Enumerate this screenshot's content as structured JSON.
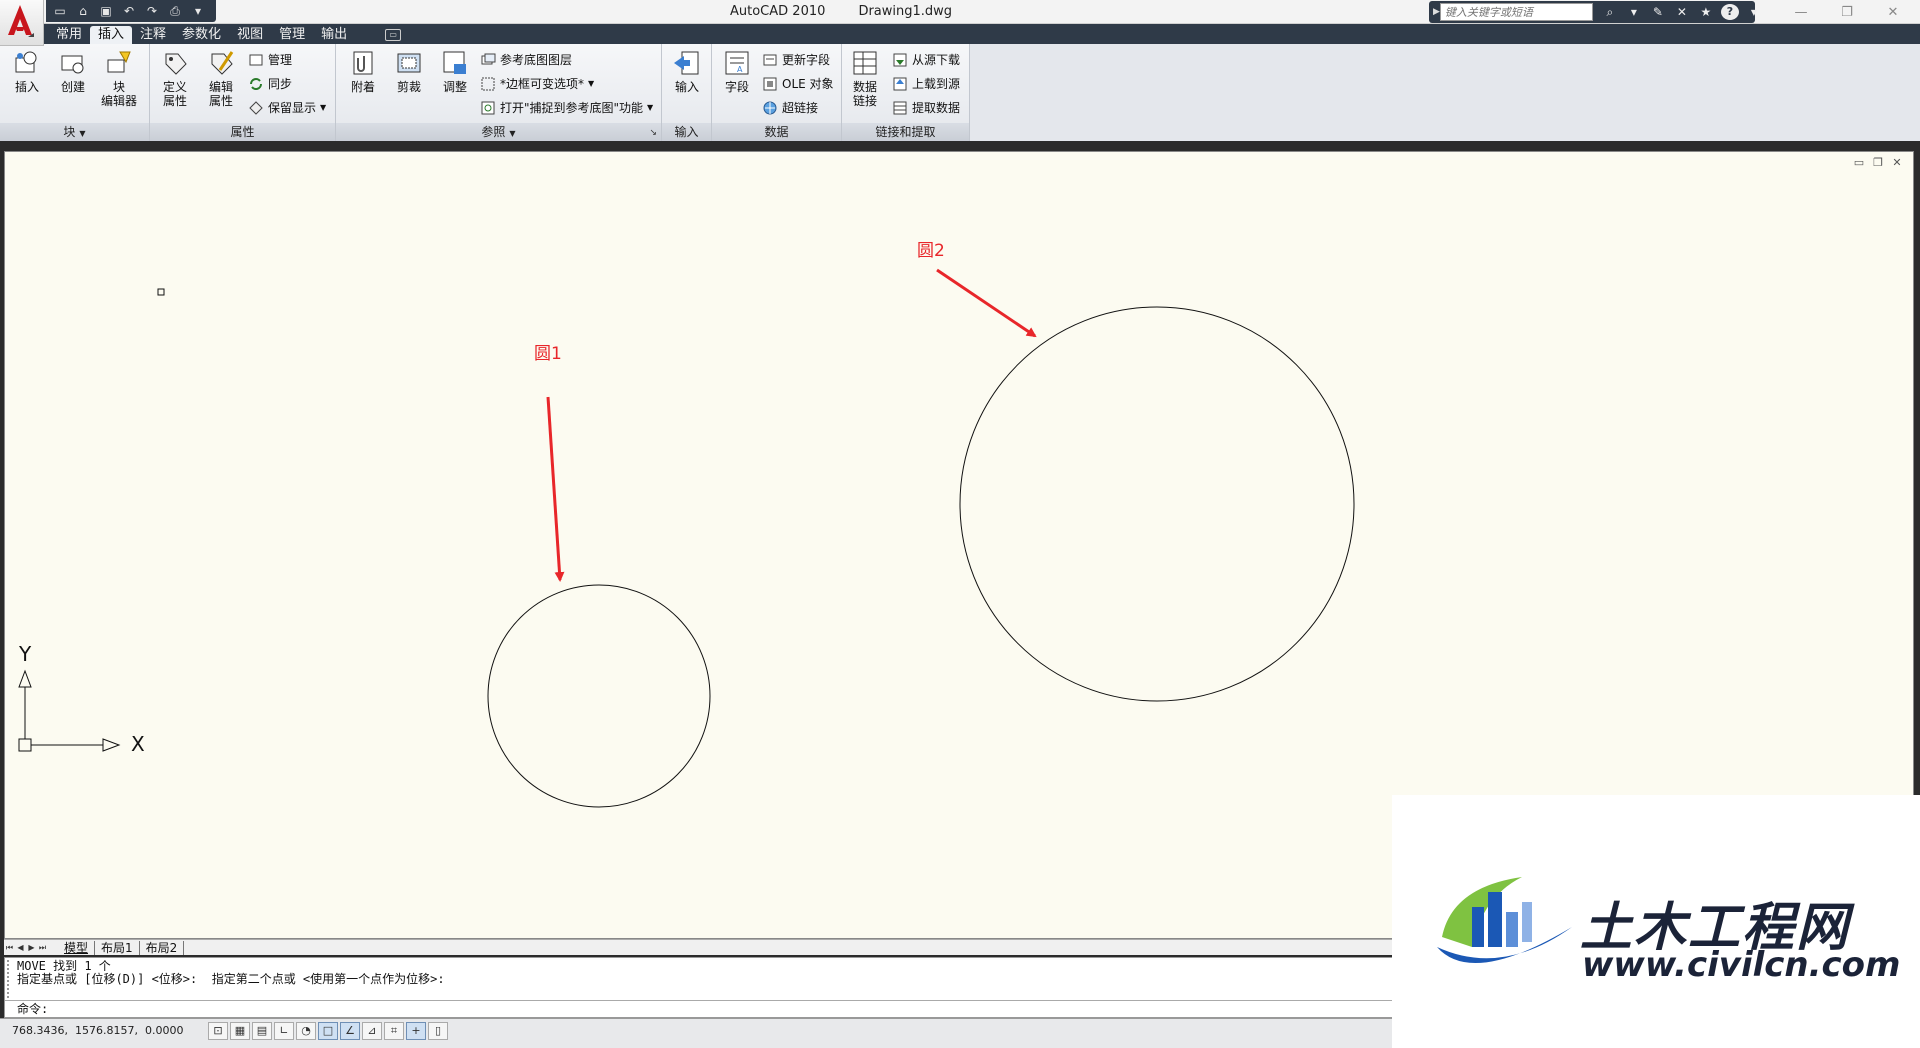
{
  "window": {
    "app_title": "AutoCAD 2010",
    "file_name": "Drawing1.dwg"
  },
  "search": {
    "placeholder": "键入关键字或短语"
  },
  "tabs": [
    {
      "label": "常用"
    },
    {
      "label": "插入"
    },
    {
      "label": "注释"
    },
    {
      "label": "参数化"
    },
    {
      "label": "视图"
    },
    {
      "label": "管理"
    },
    {
      "label": "输出"
    }
  ],
  "active_tab": "插入",
  "ribbon": {
    "block": {
      "title": "块",
      "insert": "插入",
      "create": "创建",
      "editor_l1": "块",
      "editor_l2": "编辑器"
    },
    "attributes": {
      "title": "属性",
      "define_l1": "定义",
      "define_l2": "属性",
      "edit_l1": "编辑",
      "edit_l2": "属性",
      "manage": "管理",
      "sync": "同步",
      "retain": "保留显示"
    },
    "reference": {
      "title": "参照",
      "attach": "附着",
      "clip": "剪裁",
      "adjust": "调整",
      "underlay_layers": "参考底图图层",
      "frame": "*边框可变选项*",
      "snap": "打开\"捕捉到参考底图\"功能"
    },
    "import": {
      "title": "输入",
      "import": "输入"
    },
    "data": {
      "title": "数据",
      "field": "字段",
      "update_fields": "更新字段",
      "ole": "OLE 对象",
      "hyperlink": "超链接"
    },
    "link": {
      "title": "链接和提取",
      "data_link_l1": "数据",
      "data_link_l2": "链接",
      "download": "从源下载",
      "upload": "上载到源",
      "extract": "提取数据"
    }
  },
  "drawing": {
    "label_circle1": "圆1",
    "label_circle2": "圆2",
    "ucs_x": "X",
    "ucs_y": "Y",
    "annotation_color": "#e8262a"
  },
  "layout_tabs": [
    {
      "label": "模型"
    },
    {
      "label": "布局1"
    },
    {
      "label": "布局2"
    }
  ],
  "command": {
    "line1": "MOVE 找到 1 个",
    "line2": "指定基点或 [位移(D)] <位移>:  指定第二个点或 <使用第一个点作为位移>:",
    "prompt": "命令:"
  },
  "status": {
    "coords": "768.3436,  1576.8157,  0.0000"
  },
  "watermark": {
    "title": "土木工程网",
    "url": "www.civilcn.com"
  }
}
